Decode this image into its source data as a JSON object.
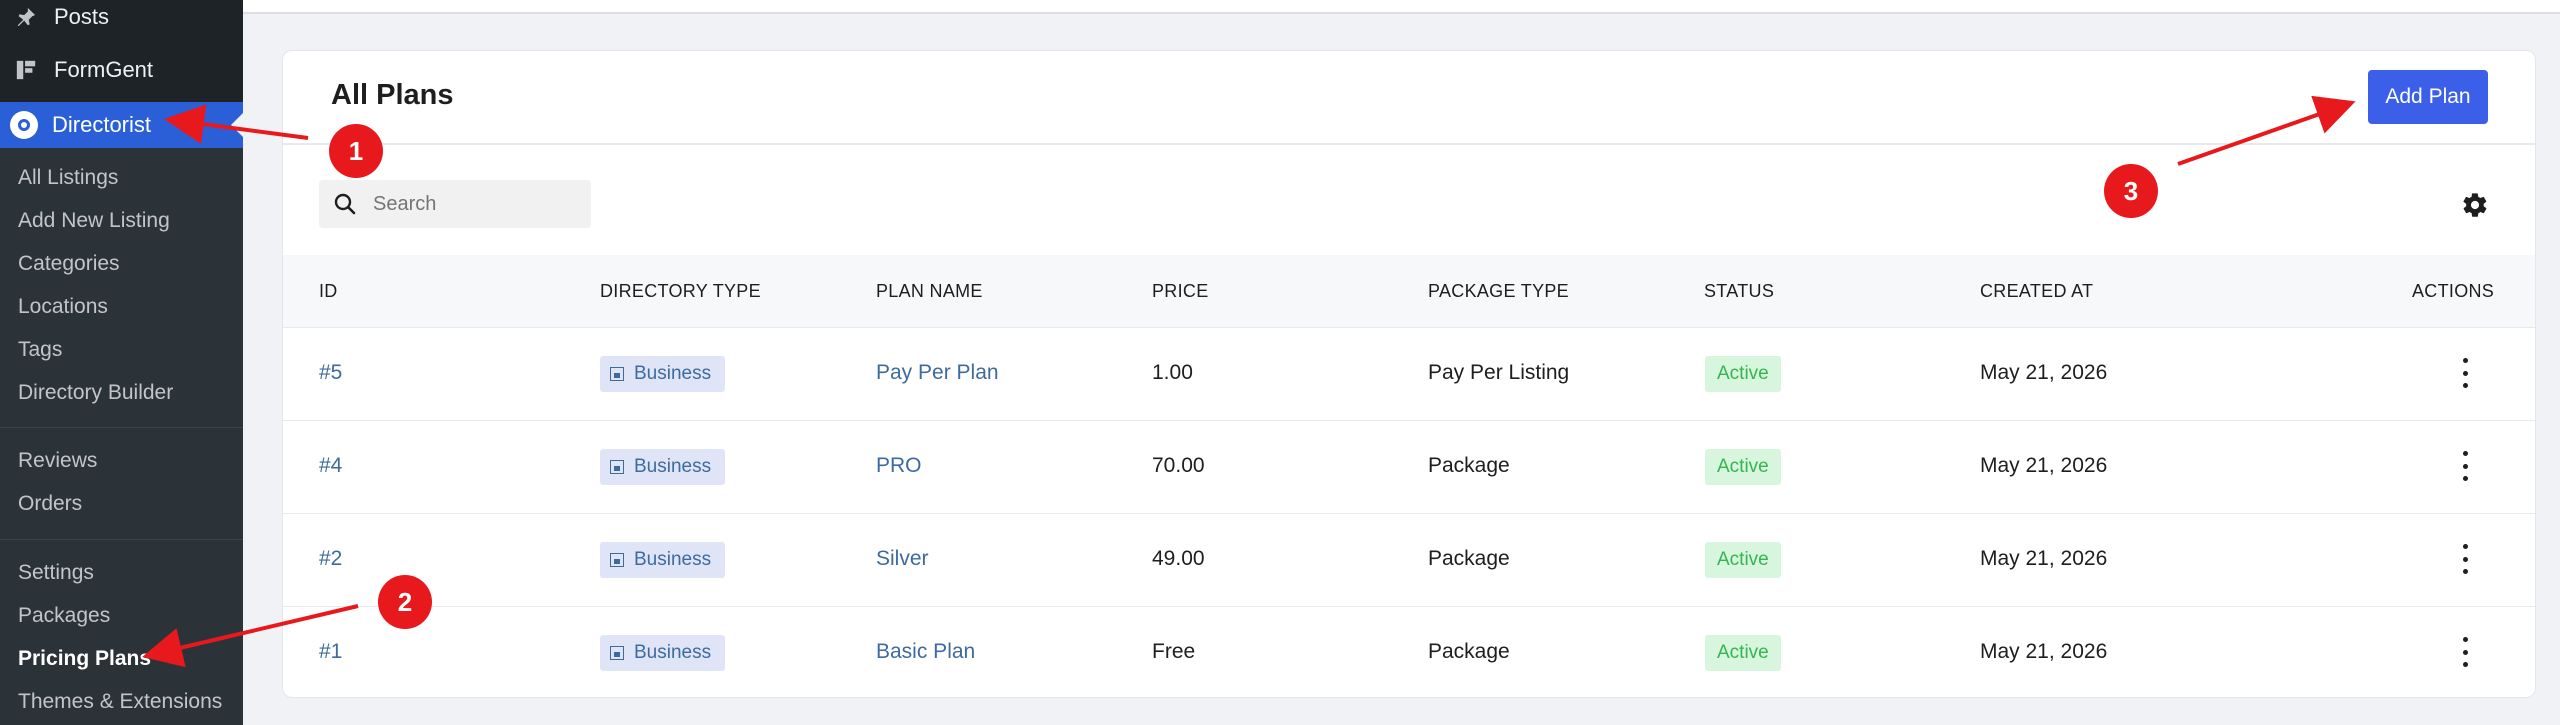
{
  "sidebar": {
    "posts": "Posts",
    "formgent": "FormGent",
    "directorist": "Directorist",
    "submenu": {
      "all_listings": "All Listings",
      "add_new_listing": "Add New Listing",
      "categories": "Categories",
      "locations": "Locations",
      "tags": "Tags",
      "directory_builder": "Directory Builder",
      "reviews": "Reviews",
      "orders": "Orders",
      "settings": "Settings",
      "packages": "Packages",
      "pricing_plans": "Pricing Plans",
      "themes_extensions": "Themes & Extensions"
    }
  },
  "main": {
    "title": "All Plans",
    "add_plan_label": "Add Plan",
    "search_placeholder": "Search",
    "columns": [
      "ID",
      "DIRECTORY TYPE",
      "PLAN NAME",
      "PRICE",
      "PACKAGE TYPE",
      "STATUS",
      "CREATED AT",
      "ACTIONS"
    ],
    "rows": [
      {
        "id": "#5",
        "directory_type": "Business",
        "plan_name": "Pay Per Plan",
        "price": "1.00",
        "package_type": "Pay Per Listing",
        "status": "Active",
        "created_at": "May 21, 2026"
      },
      {
        "id": "#4",
        "directory_type": "Business",
        "plan_name": "PRO",
        "price": "70.00",
        "package_type": "Package",
        "status": "Active",
        "created_at": "May 21, 2026"
      },
      {
        "id": "#2",
        "directory_type": "Business",
        "plan_name": "Silver",
        "price": "49.00",
        "package_type": "Package",
        "status": "Active",
        "created_at": "May 21, 2026"
      },
      {
        "id": "#1",
        "directory_type": "Business",
        "plan_name": "Basic Plan",
        "price": "Free",
        "package_type": "Package",
        "status": "Active",
        "created_at": "May 21, 2026"
      }
    ]
  },
  "annotations": {
    "step1": "1",
    "step2": "2",
    "step3": "3",
    "color": "#e8191d"
  },
  "colors": {
    "accent": "#3b5fe8",
    "sidebar_bg": "#1d2327",
    "status_active": "#35b650"
  }
}
